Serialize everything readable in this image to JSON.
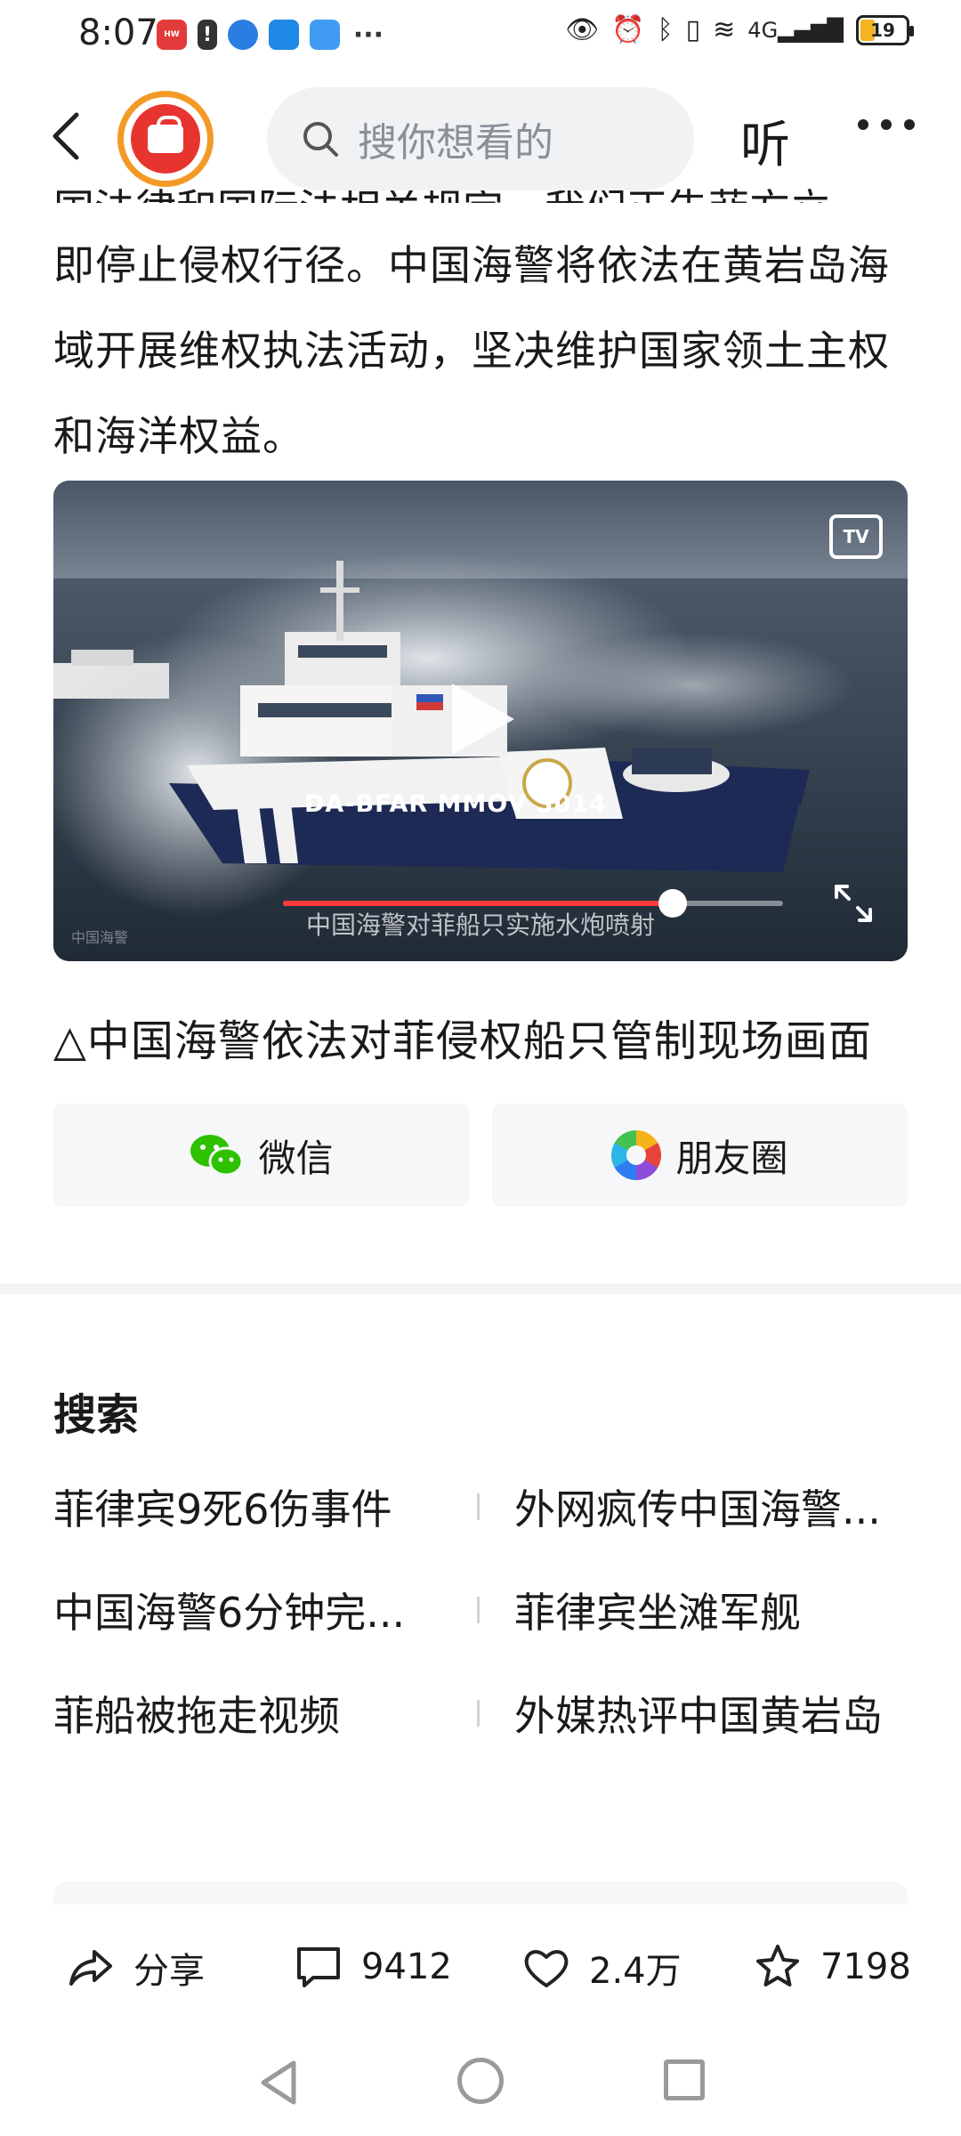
{
  "status_bar": {
    "time": "8:07",
    "network": "4G",
    "battery": "19"
  },
  "header": {
    "search_placeholder": "搜你想看的",
    "listen_label": "听"
  },
  "article": {
    "cut_line": "国法律和国际法相关规定，我们正告菲方立",
    "line_1": "即停止侵权行径。中国海警将依法在黄岩岛海",
    "line_2": "域开展维权执法活动，坚决维护国家领土主权",
    "line_3": "和海洋权益。"
  },
  "video": {
    "tv_label": "TV",
    "boat_text": "DA-BFAR MMOV 3014",
    "subtitle": "中国海警对菲船只实施水炮喷射",
    "watermark": "中国海警",
    "progress": 0.78
  },
  "caption": "△中国海警依法对菲侵权船只管制现场画面",
  "share": {
    "wechat_label": "微信",
    "moments_label": "朋友圈"
  },
  "search_section": {
    "title": "搜索",
    "rows": [
      {
        "left": "菲律宾9死6伤事件",
        "right": "外网疯传中国海警..."
      },
      {
        "left": "中国海警6分钟完...",
        "right": "菲律宾坐滩军舰"
      },
      {
        "left": "菲船被拖走视频",
        "right": "外媒热评中国黄岩岛"
      }
    ]
  },
  "actions": {
    "share_label": "分享",
    "comment_count": "9412",
    "like_count": "2.4万",
    "favorite_count": "7198"
  },
  "icons": {
    "back": "chevron-left-icon",
    "search": "search-icon",
    "more": "more-dots-icon",
    "tv": "tv-cast-icon",
    "play": "play-icon",
    "expand": "fullscreen-icon",
    "wechat": "wechat-icon",
    "moments": "moments-icon",
    "share": "share-arrow-icon",
    "comment": "comment-icon",
    "like": "heart-icon",
    "favorite": "star-icon"
  },
  "colors": {
    "link": "#2b6bd6",
    "progress": "#ff3b3b",
    "logo_ring": "#f39a26",
    "logo_fill": "#e8342f",
    "wechat_green": "#2dc100"
  }
}
